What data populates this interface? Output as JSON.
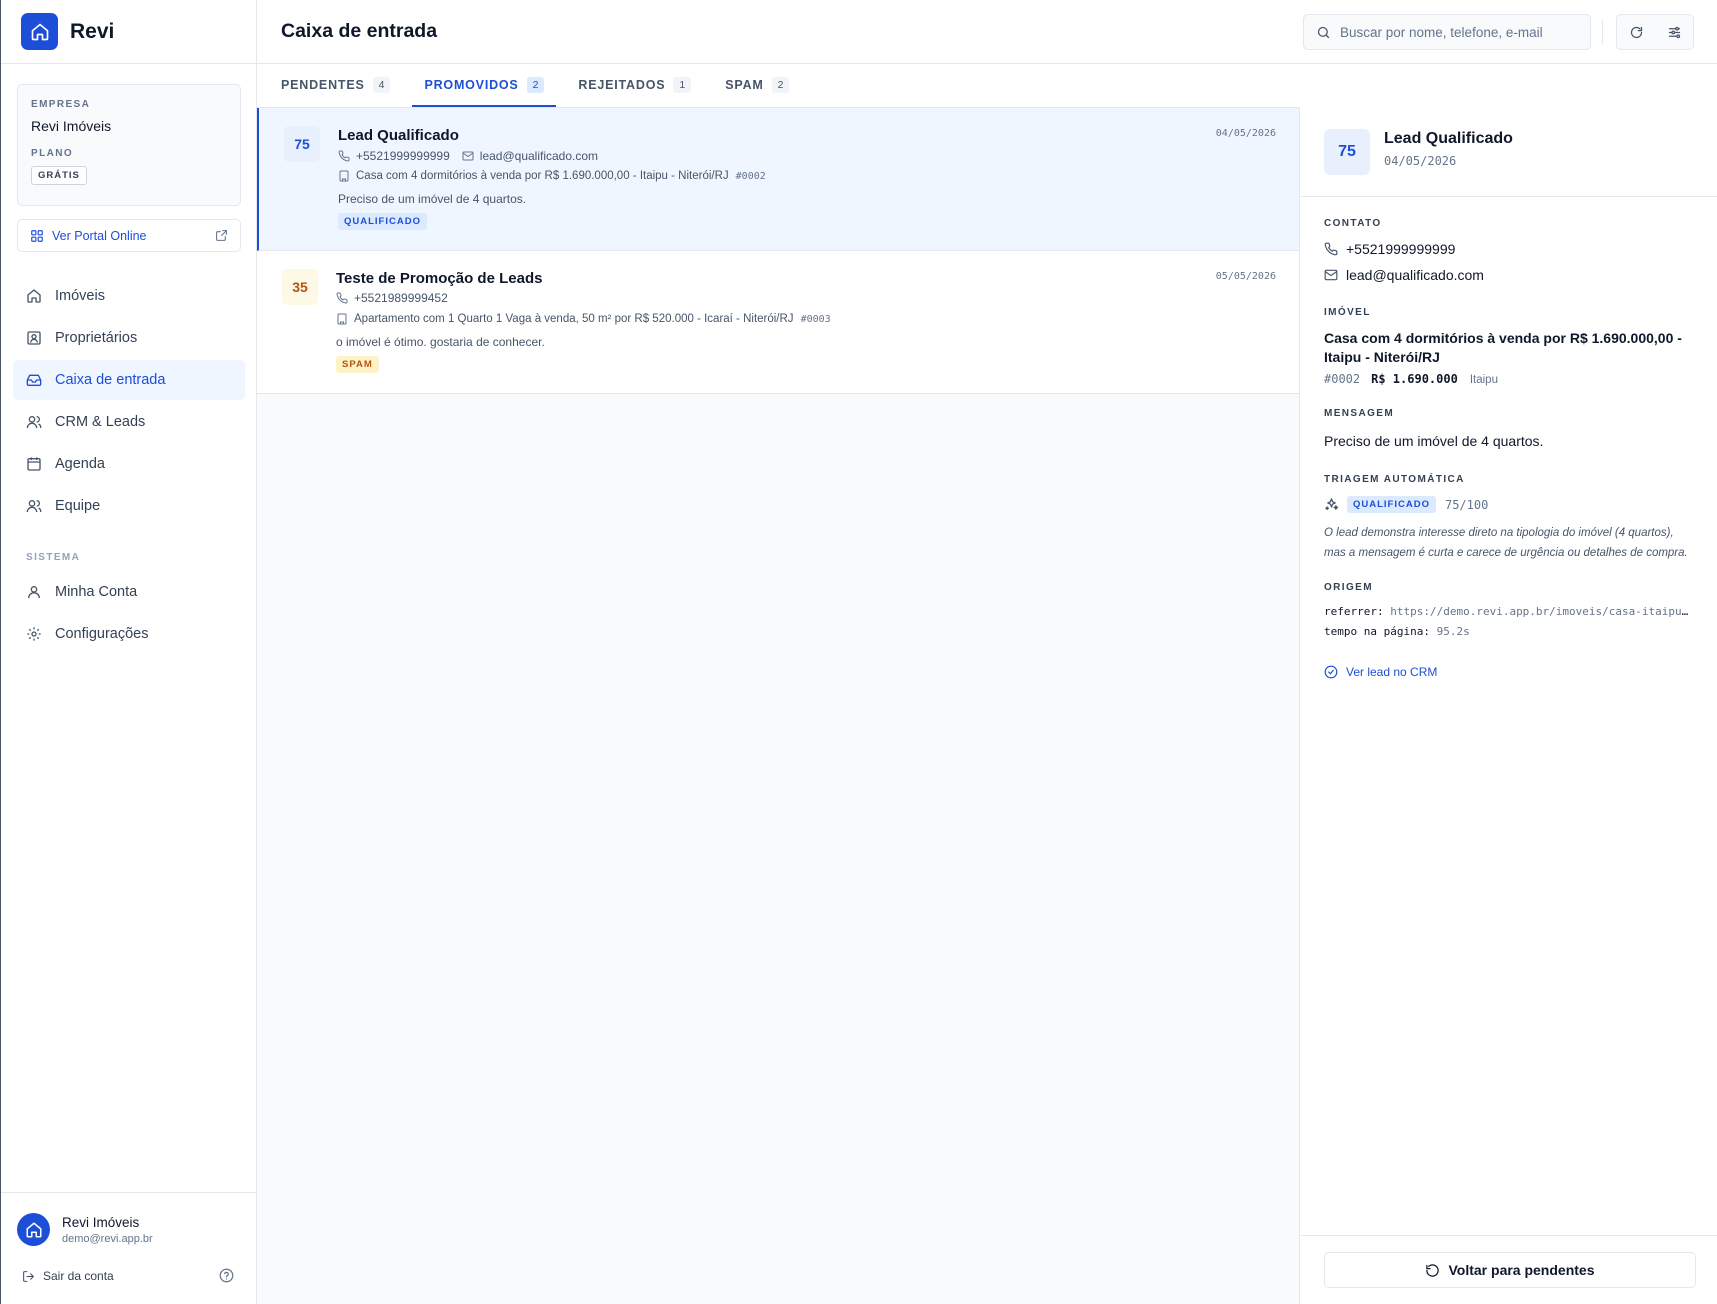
{
  "brand": {
    "name": "Revi",
    "logo_icon": "home-icon",
    "color": "#1d4ed8"
  },
  "company": {
    "company_label": "EMPRESA",
    "company_name": "Revi Imóveis",
    "plan_label": "PLANO",
    "plan_value": "GRÁTIS"
  },
  "portal_button": {
    "label": "Ver Portal Online"
  },
  "nav": {
    "items": [
      {
        "label": "Imóveis",
        "icon": "home-icon"
      },
      {
        "label": "Proprietários",
        "icon": "contact-icon"
      },
      {
        "label": "Caixa de entrada",
        "icon": "inbox-icon",
        "active": true
      },
      {
        "label": "CRM & Leads",
        "icon": "users-icon"
      },
      {
        "label": "Agenda",
        "icon": "calendar-icon"
      },
      {
        "label": "Equipe",
        "icon": "team-icon"
      }
    ],
    "system_section": "SISTEMA",
    "system_items": [
      {
        "label": "Minha Conta",
        "icon": "user-icon"
      },
      {
        "label": "Configurações",
        "icon": "gear-icon"
      }
    ]
  },
  "user": {
    "name": "Revi Imóveis",
    "email": "demo@revi.app.br",
    "logout_label": "Sair da conta"
  },
  "header": {
    "title": "Caixa de entrada",
    "search_placeholder": "Buscar por nome, telefone, e-mail"
  },
  "tabs": [
    {
      "label": "PENDENTES",
      "count": "4"
    },
    {
      "label": "PROMOVIDOS",
      "count": "2",
      "active": true
    },
    {
      "label": "REJEITADOS",
      "count": "1"
    },
    {
      "label": "SPAM",
      "count": "2"
    }
  ],
  "leads": [
    {
      "score": "75",
      "name": "Lead Qualificado",
      "date": "04/05/2026",
      "phone": "+5521999999999",
      "email": "lead@qualificado.com",
      "property": "Casa com 4 dormitórios à venda por R$ 1.690.000,00 - Itaipu - Niterói/RJ",
      "code": "#0002",
      "message": "Preciso de um imóvel de 4 quartos.",
      "tag": "QUALIFICADO",
      "selected": true
    },
    {
      "score": "35",
      "name": "Teste de Promoção de Leads",
      "date": "05/05/2026",
      "phone": "+5521989999452",
      "property": "Apartamento com 1 Quarto 1 Vaga à venda, 50 m² por R$ 520.000 - Icaraí - Niterói/RJ",
      "code": "#0003",
      "message": "o imóvel é ótimo. gostaria de conhecer.",
      "tag": "SPAM"
    }
  ],
  "detail": {
    "score": "75",
    "name": "Lead Qualificado",
    "date": "04/05/2026",
    "contact_label": "CONTATO",
    "phone": "+5521999999999",
    "email": "lead@qualificado.com",
    "property_label": "IMÓVEL",
    "property": "Casa com 4 dormitórios à venda por R$ 1.690.000,00 - Itaipu - Niterói/RJ",
    "code": "#0002",
    "price": "R$ 1.690.000",
    "neighborhood": "Itaipu",
    "message_label": "MENSAGEM",
    "message": "Preciso de um imóvel de 4 quartos.",
    "triage_label": "TRIAGEM AUTOMÁTICA",
    "triage_tag": "QUALIFICADO",
    "triage_score": "75/100",
    "triage_reason": "O lead demonstra interesse direto na tipologia do imóvel (4 quartos), mas a mensagem é curta e carece de urgência ou detalhes de compra.",
    "origin_label": "ORIGEM",
    "referrer_key": "referrer:",
    "referrer_value": "https://demo.revi.app.br/imoveis/casa-itaipu-niteroi",
    "time_key": "tempo na página:",
    "time_value": "95.2s",
    "crm_link": "Ver lead no CRM",
    "back_button": "Voltar para pendentes"
  }
}
